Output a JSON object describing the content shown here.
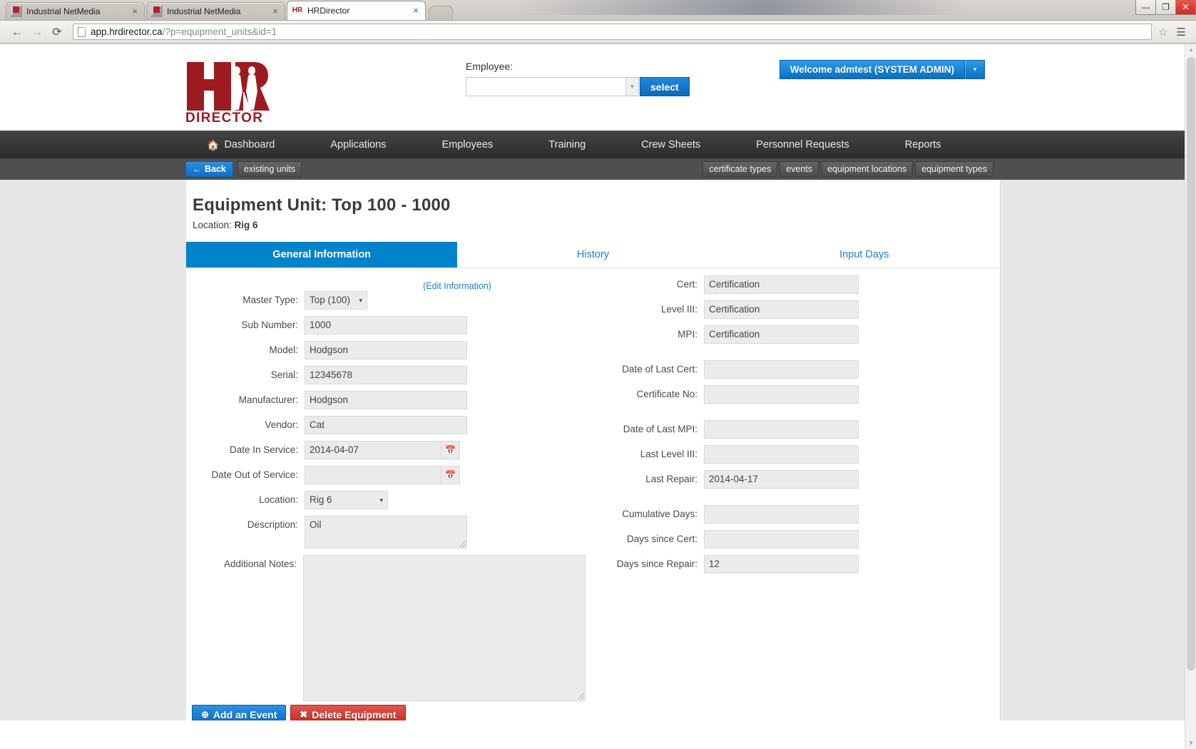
{
  "browser": {
    "tabs": [
      {
        "title": "Industrial NetMedia",
        "favicon": "netmedia-icon",
        "active": false
      },
      {
        "title": "Industrial NetMedia",
        "favicon": "netmedia-icon",
        "active": false
      },
      {
        "title": "HRDirector",
        "favicon": "hrdirector-icon",
        "active": true
      }
    ],
    "close_glyph": "×",
    "window_controls": {
      "minimize": "—",
      "maximize": "❐",
      "close": "✕"
    },
    "nav": {
      "back": "←",
      "forward": "→",
      "reload": "⟳"
    },
    "url_host": "app.hrdirector.ca",
    "url_path": "/?p=equipment_units&id=1",
    "star_glyph": "☆",
    "menu_glyph": "☰"
  },
  "header": {
    "logo_text": "DIRECTOR",
    "logo_mark": "HR",
    "employee_label": "Employee:",
    "employee_value": "",
    "employee_placeholder": "",
    "select_button": "select",
    "welcome_text": "Welcome admtest (SYSTEM ADMIN)",
    "welcome_caret": "▾",
    "brand_color": "#9d1b20",
    "accent_color": "#0083ca"
  },
  "mainnav": {
    "items": [
      {
        "label": "Dashboard",
        "icon": "home-icon"
      },
      {
        "label": "Applications",
        "icon": ""
      },
      {
        "label": "Employees",
        "icon": ""
      },
      {
        "label": "Training",
        "icon": ""
      },
      {
        "label": "Crew Sheets",
        "icon": ""
      },
      {
        "label": "Personnel Requests",
        "icon": ""
      },
      {
        "label": "Reports",
        "icon": ""
      }
    ]
  },
  "subnav": {
    "back_label": "Back",
    "back_arrow": "←",
    "existing_units": "existing units",
    "right_items": [
      {
        "label": "certificate types"
      },
      {
        "label": "events"
      },
      {
        "label": "equipment locations"
      },
      {
        "label": "equipment types"
      }
    ]
  },
  "page": {
    "title": "Equipment Unit: Top 100 - 1000",
    "location_prefix": "Location: ",
    "location_value": "Rig 6",
    "tabs": [
      {
        "label": "General Information",
        "active": true
      },
      {
        "label": "History",
        "active": false
      },
      {
        "label": "Input Days",
        "active": false
      }
    ],
    "edit_link": "(Edit Information)"
  },
  "form_left": {
    "master_type": {
      "label": "Master Type:",
      "value": "Top (100)",
      "caret": "▾"
    },
    "sub_number": {
      "label": "Sub Number:",
      "value": "1000"
    },
    "model": {
      "label": "Model:",
      "value": "Hodgson"
    },
    "serial": {
      "label": "Serial:",
      "value": "12345678"
    },
    "manufacturer": {
      "label": "Manufacturer:",
      "value": "Hodgson"
    },
    "vendor": {
      "label": "Vendor:",
      "value": "Cat"
    },
    "date_in_service": {
      "label": "Date In Service:",
      "value": "2014-04-07",
      "icon": "calendar-icon"
    },
    "date_out_of_service": {
      "label": "Date Out of Service:",
      "value": "",
      "icon": "calendar-icon"
    },
    "location": {
      "label": "Location:",
      "value": "Rig 6",
      "caret": "▾"
    },
    "description": {
      "label": "Description:",
      "value": "Oil"
    },
    "additional_notes": {
      "label": "Additional Notes:",
      "value": ""
    }
  },
  "form_right": {
    "cert": {
      "label": "Cert:",
      "value": "Certification"
    },
    "level_iii": {
      "label": "Level III:",
      "value": "Certification"
    },
    "mpi": {
      "label": "MPI:",
      "value": "Certification"
    },
    "date_of_last_cert": {
      "label": "Date of Last Cert:",
      "value": ""
    },
    "certificate_no": {
      "label": "Certificate No:",
      "value": ""
    },
    "date_of_last_mpi": {
      "label": "Date of Last MPI:",
      "value": ""
    },
    "last_level_iii": {
      "label": "Last Level III:",
      "value": ""
    },
    "last_repair": {
      "label": "Last Repair:",
      "value": "2014-04-17"
    },
    "cumulative_days": {
      "label": "Cumulative Days:",
      "value": ""
    },
    "days_since_cert": {
      "label": "Days since Cert:",
      "value": ""
    },
    "days_since_repair": {
      "label": "Days since Repair:",
      "value": "12"
    }
  },
  "footer": {
    "add_event": {
      "label": "Add an Event",
      "icon": "⊕"
    },
    "delete_equipment": {
      "label": "Delete Equipment",
      "icon": "✖"
    }
  },
  "scrollbar": {
    "up": "▲",
    "down": "▼"
  }
}
